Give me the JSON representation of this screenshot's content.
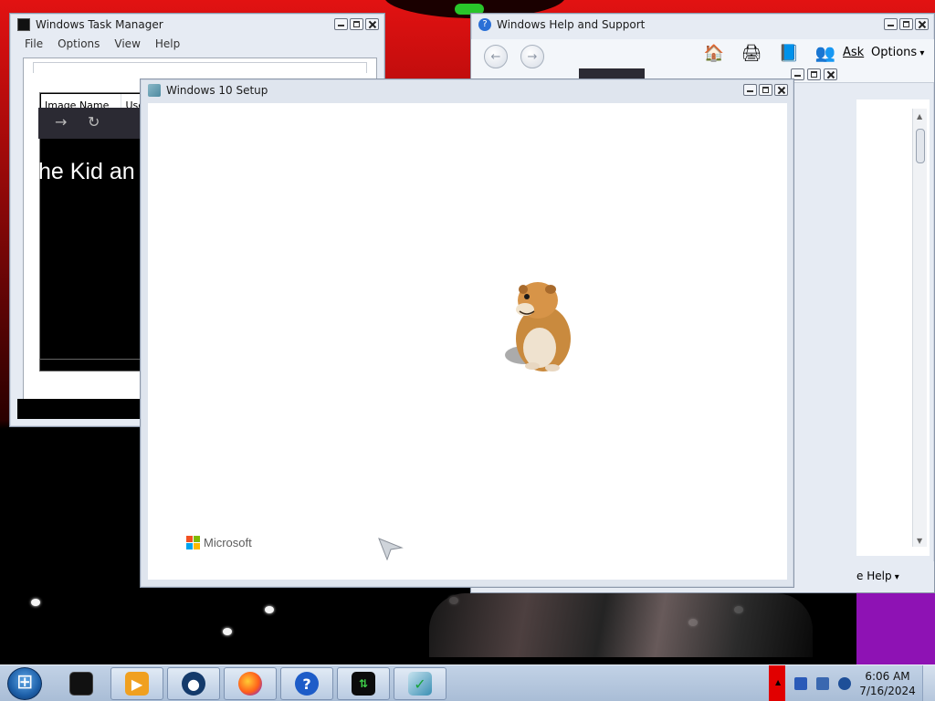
{
  "task_manager": {
    "title": "Windows Task Manager",
    "menu": [
      "File",
      "Options",
      "View",
      "Help"
    ],
    "columns": [
      "Image Name",
      "Use"
    ]
  },
  "browser_behind": {
    "heading": "he Kid an"
  },
  "help_support": {
    "title": "Windows Help and Support",
    "ask_label": "Ask",
    "options_label": "Options",
    "browse_help_label": "e Help"
  },
  "setup": {
    "title": "Windows 10 Setup",
    "brand_label": "Microsoft"
  },
  "taskbar": {
    "apps": [
      "command-prompt",
      "media-player",
      "windows-explorer-globe",
      "firefox",
      "help-and-support",
      "task-manager-graph",
      "windows-setup"
    ],
    "clock_time": "6:06 AM",
    "clock_date": "7/16/2024"
  },
  "colors": {
    "desktop_red": "#e21212",
    "desktop_purple": "#8e12b4",
    "ms_red": "#f25022",
    "ms_green": "#7fba00",
    "ms_blue": "#00a4ef",
    "ms_yellow": "#ffb900"
  }
}
